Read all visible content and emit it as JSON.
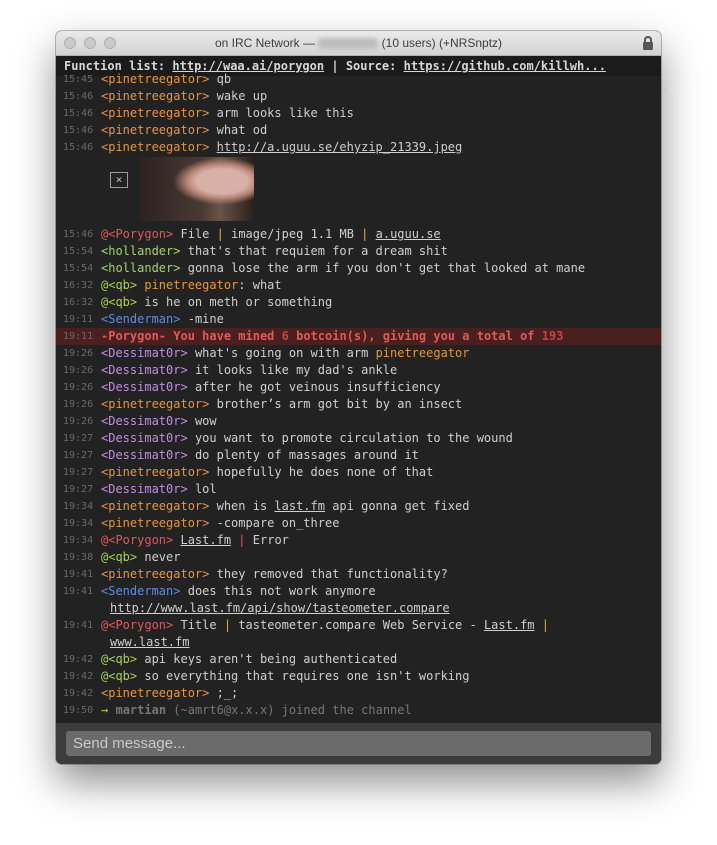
{
  "window": {
    "title_left": "on IRC Network — ",
    "title_right": "(10 users) (+NRSnptz)",
    "topic_label1": "Function list:",
    "topic_link1": "http://waa.ai/porygon",
    "topic_sep": "|",
    "topic_label2": "Source:",
    "topic_link2": "https://github.com/killwh..."
  },
  "messages": [
    {
      "time": "15:45",
      "nick": "<pinetreegator>",
      "text": "qb"
    },
    {
      "time": "15:46",
      "nick": "<pinetreegator>",
      "text": "wake up"
    },
    {
      "time": "15:46",
      "nick": "<pinetreegator>",
      "text": "arm looks like this"
    },
    {
      "time": "15:46",
      "nick": "<pinetreegator>",
      "text": "what od"
    },
    {
      "time": "15:46",
      "nick": "<pinetreegator>",
      "link": "http://a.uguu.se/ehyzip_21339.jpeg"
    },
    {
      "time": "15:46",
      "nick": "@<Porygon>",
      "p1": "File",
      "sep1": "|",
      "p2": "image/jpeg 1.1 MB",
      "sep2": "|",
      "link": "a.uguu.se"
    },
    {
      "time": "15:54",
      "nick": "<hollander>",
      "text": "that's that requiem for a dream shit"
    },
    {
      "time": "15:54",
      "nick": "<hollander>",
      "text": "gonna lose the arm if you don't get that looked at mane"
    },
    {
      "time": "16:32",
      "nick": "@<qb>",
      "mention": "pinetreegator",
      "text": ": what"
    },
    {
      "time": "16:32",
      "nick": "@<qb>",
      "text": "is he on meth or something"
    },
    {
      "time": "19:11",
      "nick": "<Senderman>",
      "text": "-mine"
    },
    {
      "time": "19:11",
      "nick": "-Porygon-",
      "text_pre": "You have mined ",
      "n1": "6",
      "text_mid": " botcoin(s), giving you a total of ",
      "n2": "193"
    },
    {
      "time": "19:26",
      "nick": "<Dessimat0r>",
      "text": "what's going on with arm ",
      "mention": "pinetreegator"
    },
    {
      "time": "19:26",
      "nick": "<Dessimat0r>",
      "text": "it looks like my dad's ankle"
    },
    {
      "time": "19:26",
      "nick": "<Dessimat0r>",
      "text": "after he got veinous insufficiency"
    },
    {
      "time": "19:26",
      "nick": "<pinetreegator>",
      "text": "brother’s arm got bit by an insect"
    },
    {
      "time": "19:26",
      "nick": "<Dessimat0r>",
      "text": "wow"
    },
    {
      "time": "19:27",
      "nick": "<Dessimat0r>",
      "text": "you want to promote circulation to the wound"
    },
    {
      "time": "19:27",
      "nick": "<Dessimat0r>",
      "text": "do plenty of massages around it"
    },
    {
      "time": "19:27",
      "nick": "<pinetreegator>",
      "text": "hopefully he does none of that"
    },
    {
      "time": "19:27",
      "nick": "<Dessimat0r>",
      "text": "lol"
    },
    {
      "time": "19:34",
      "nick": "<pinetreegator>",
      "pre": "when is ",
      "link": "last.fm",
      "text": " api gonna get fixed"
    },
    {
      "time": "19:34",
      "nick": "<pinetreegator>",
      "text": "-compare on_three"
    },
    {
      "time": "19:34",
      "nick": "@<Porygon>",
      "link": "Last.fm",
      "sep": "|",
      "text": "Error"
    },
    {
      "time": "19:38",
      "nick": "@<qb>",
      "text": "never"
    },
    {
      "time": "19:41",
      "nick": "<pinetreegator>",
      "text": "they removed that functionality?"
    },
    {
      "time": "19:41",
      "nick": "<Senderman>",
      "text": "does this not work anymore",
      "link": "http://www.last.fm/api/show/tasteometer.compare"
    },
    {
      "time": "19:41",
      "nick": "@<Porygon>",
      "p1": "Title",
      "sep1": "|",
      "p2": "tasteometer.compare Web Service - ",
      "link1": "Last.fm",
      "sep2": "|",
      "link2": "www.last.fm"
    },
    {
      "time": "19:42",
      "nick": "@<qb>",
      "text": "api keys aren't being authenticated"
    },
    {
      "time": "19:42",
      "nick": "@<qb>",
      "text": "so everything that requires one isn't working"
    },
    {
      "time": "19:42",
      "nick": "<pinetreegator>",
      "text": ";_;"
    },
    {
      "time": "19:50",
      "arrow": "→",
      "nick": "martian",
      "host": "(~amrt6@x.x.x)",
      "text": "joined the channel"
    }
  ],
  "image_preview": {
    "broken_icon": "×"
  },
  "input": {
    "placeholder": "Send message..."
  }
}
